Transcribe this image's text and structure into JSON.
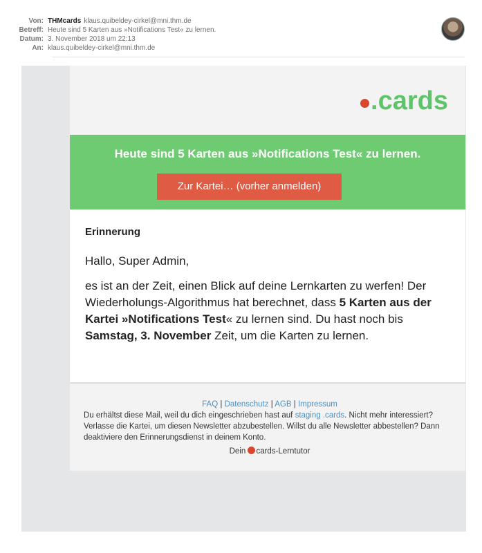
{
  "header": {
    "from_label": "Von:",
    "from_name": "THMcards",
    "from_email": "klaus.quibeldey-cirkel@mni.thm.de",
    "subject_label": "Betreff:",
    "subject": "Heute sind 5 Karten aus »Notifications Test« zu lernen.",
    "date_label": "Datum:",
    "date": "3. November 2018 um 22:13",
    "to_label": "An:",
    "to": "klaus.quibeldey-cirkel@mni.thm.de"
  },
  "logo": {
    "text": "cards",
    "icon": "tomato-icon",
    "color": "#5ec46a"
  },
  "banner": {
    "title": "Heute sind 5 Karten aus »Notifications Test« zu lernen.",
    "button": "Zur Kartei… (vorher anmelden)",
    "bg_color": "#6ecb72",
    "button_color": "#e05b43"
  },
  "body": {
    "heading": "Erinnerung",
    "greeting": "Hallo, Super Admin,",
    "p1": "es ist an der Zeit, einen Blick auf deine Lernkarten zu werfen! Der Wiederholungs-Algorithmus hat berechnet, dass ",
    "p_bold1": "5 Karten aus der Kartei »Notifications Test",
    "p2": "« zu lernen sind. Du hast noch bis ",
    "p_bold2": "Samstag, 3. November",
    "p3": " Zeit, um die Karten zu lernen."
  },
  "footer": {
    "links": [
      "FAQ",
      "Datenschutz",
      "AGB",
      "Impressum"
    ],
    "line1_a": "Du erhältst diese Mail, weil du dich eingeschrieben hast auf ",
    "line1_link": "staging .cards",
    "line1_b": ". Nicht mehr interessiert? Verlasse die Kartei, um diesen Newsletter abzubestellen. Willst du alle Newsletter abbestellen? Dann deaktiviere den Erinnerungsdienst in deinem Konto.",
    "sign_prefix": "Dein ",
    "sign_suffix": "cards-Lerntutor"
  }
}
